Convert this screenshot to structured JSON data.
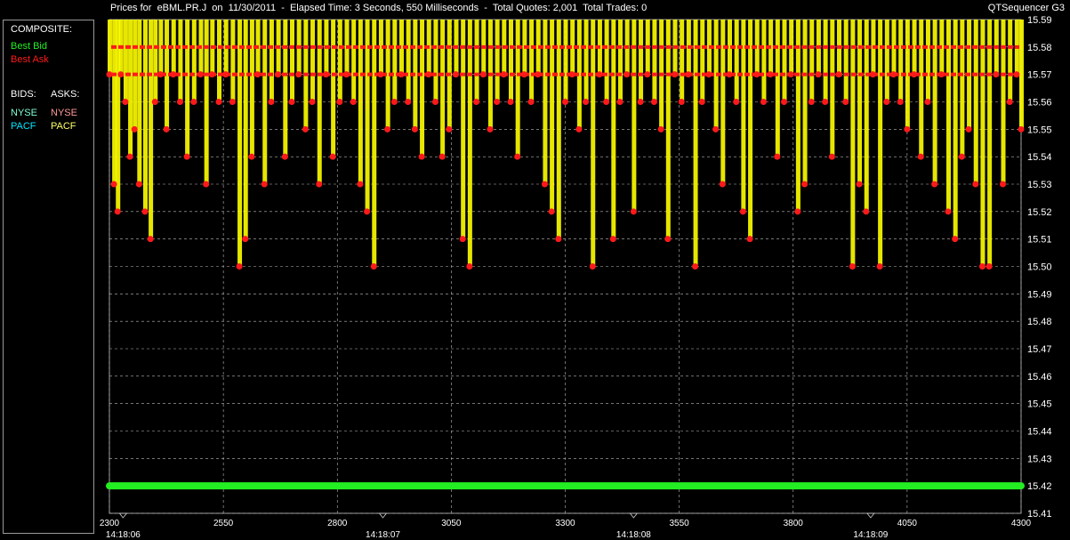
{
  "header": {
    "title": "Prices for  eBML.PR.J  on  11/30/2011  -  Elapsed Time: 3 Seconds, 550 Milliseconds  -  Total Quotes: 2,001  Total Trades: 0",
    "app_name": "QTSequencer G3"
  },
  "legend": {
    "composite_label": "COMPOSITE:",
    "best_bid": "Best Bid",
    "best_ask": "Best Ask",
    "bids_label": "BIDS:",
    "asks_label": "ASKS:",
    "bid_nyse": "NYSE",
    "bid_pacf": "PACF",
    "ask_nyse": "NYSE",
    "ask_pacf": "PACF"
  },
  "colors": {
    "best_bid": "#22ee22",
    "best_ask": "#ff1a1a",
    "bid_nyse": "#00ffff",
    "bid_pacf": "#00ffff",
    "ask_nyse": "#ff9999",
    "ask_pacf": "#ffff66",
    "ask_fill": "#ffff00",
    "grid": "#bbbbbb"
  },
  "chart_data": {
    "type": "line",
    "title": "Prices for  eBML.PR.J  on  11/30/2011",
    "xlabel": "",
    "ylabel": "",
    "xlim": [
      2300,
      4300
    ],
    "ylim": [
      15.41,
      15.59
    ],
    "x_ticks": [
      "2300",
      "2550",
      "2800",
      "3050",
      "3300",
      "3550",
      "3800",
      "4050",
      "4300"
    ],
    "time_ticks": [
      {
        "x": 2330,
        "label": "14:18:06"
      },
      {
        "x": 2900,
        "label": "14:18:07"
      },
      {
        "x": 3450,
        "label": "14:18:08"
      },
      {
        "x": 3970,
        "label": "14:18:09"
      }
    ],
    "y_ticks": [
      "15.59",
      "15.58",
      "15.57",
      "15.56",
      "15.55",
      "15.54",
      "15.53",
      "15.52",
      "15.51",
      "15.50",
      "15.49",
      "15.48",
      "15.47",
      "15.46",
      "15.45",
      "15.44",
      "15.43",
      "15.42",
      "15.41"
    ],
    "grid": true,
    "series": [
      {
        "name": "Best Bid",
        "x": [
          2300,
          4300
        ],
        "y": [
          15.42,
          15.42
        ]
      },
      {
        "name": "Best Ask",
        "x": [
          2300,
          2310,
          2318,
          2325,
          2335,
          2345,
          2355,
          2365,
          2378,
          2390,
          2400,
          2412,
          2425,
          2440,
          2455,
          2470,
          2485,
          2500,
          2512,
          2525,
          2540,
          2555,
          2570,
          2585,
          2598,
          2612,
          2625,
          2640,
          2655,
          2670,
          2685,
          2700,
          2715,
          2730,
          2745,
          2760,
          2775,
          2790,
          2805,
          2820,
          2835,
          2850,
          2865,
          2880,
          2895,
          2910,
          2925,
          2940,
          2955,
          2970,
          2985,
          3000,
          3015,
          3030,
          3045,
          3060,
          3075,
          3090,
          3105,
          3120,
          3135,
          3150,
          3165,
          3180,
          3195,
          3210,
          3225,
          3240,
          3255,
          3270,
          3285,
          3300,
          3315,
          3330,
          3345,
          3360,
          3375,
          3390,
          3405,
          3420,
          3435,
          3450,
          3465,
          3480,
          3495,
          3510,
          3525,
          3540,
          3555,
          3570,
          3585,
          3600,
          3615,
          3630,
          3645,
          3660,
          3675,
          3690,
          3705,
          3720,
          3735,
          3750,
          3765,
          3780,
          3795,
          3810,
          3825,
          3840,
          3855,
          3870,
          3885,
          3900,
          3915,
          3930,
          3945,
          3960,
          3975,
          3990,
          4005,
          4020,
          4035,
          4050,
          4065,
          4080,
          4095,
          4110,
          4125,
          4140,
          4155,
          4170,
          4185,
          4200,
          4215,
          4230,
          4245,
          4260,
          4275,
          4290,
          4300
        ],
        "y": [
          15.57,
          15.53,
          15.52,
          15.57,
          15.56,
          15.54,
          15.55,
          15.53,
          15.52,
          15.51,
          15.56,
          15.57,
          15.55,
          15.57,
          15.56,
          15.54,
          15.56,
          15.57,
          15.53,
          15.57,
          15.56,
          15.57,
          15.56,
          15.5,
          15.51,
          15.54,
          15.57,
          15.53,
          15.56,
          15.57,
          15.54,
          15.56,
          15.57,
          15.55,
          15.56,
          15.53,
          15.57,
          15.54,
          15.56,
          15.57,
          15.56,
          15.53,
          15.52,
          15.5,
          15.57,
          15.55,
          15.56,
          15.57,
          15.56,
          15.55,
          15.54,
          15.57,
          15.56,
          15.54,
          15.55,
          15.57,
          15.51,
          15.5,
          15.56,
          15.57,
          15.55,
          15.56,
          15.57,
          15.56,
          15.54,
          15.57,
          15.56,
          15.57,
          15.53,
          15.52,
          15.51,
          15.56,
          15.57,
          15.55,
          15.56,
          15.5,
          15.57,
          15.56,
          15.51,
          15.56,
          15.57,
          15.52,
          15.56,
          15.57,
          15.56,
          15.55,
          15.51,
          15.57,
          15.56,
          15.57,
          15.5,
          15.56,
          15.57,
          15.55,
          15.53,
          15.57,
          15.56,
          15.52,
          15.51,
          15.57,
          15.56,
          15.57,
          15.54,
          15.56,
          15.57,
          15.52,
          15.53,
          15.56,
          15.57,
          15.56,
          15.54,
          15.57,
          15.56,
          15.5,
          15.53,
          15.52,
          15.57,
          15.5,
          15.56,
          15.57,
          15.56,
          15.55,
          15.57,
          15.54,
          15.56,
          15.53,
          15.57,
          15.52,
          15.51,
          15.54,
          15.55,
          15.53,
          15.5,
          15.5,
          15.57,
          15.53,
          15.56,
          15.57,
          15.55
        ]
      }
    ]
  }
}
